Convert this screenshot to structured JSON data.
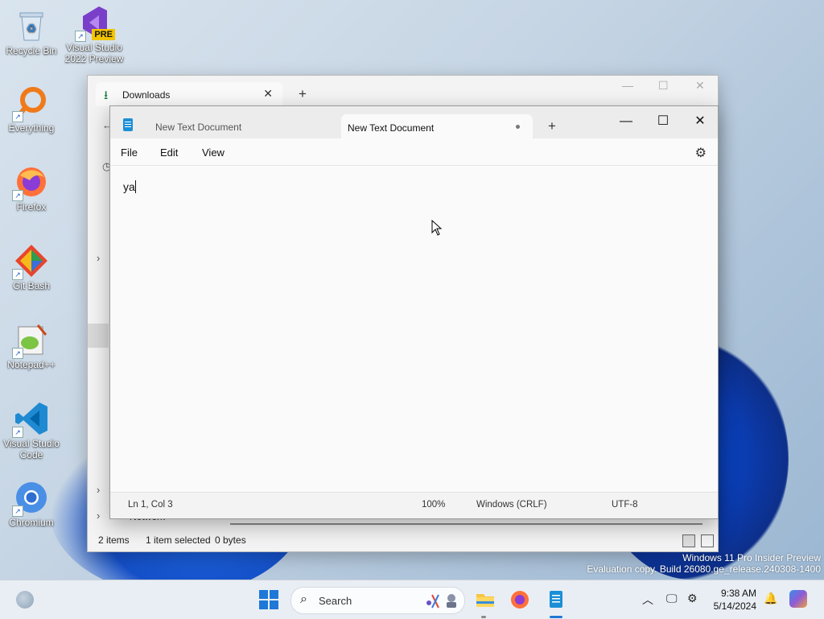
{
  "desktop": {
    "icons": [
      {
        "label": "Recycle Bin"
      },
      {
        "label": "Visual Studio 2022 Preview",
        "badge": "PRE"
      },
      {
        "label": "Everything"
      },
      {
        "label": "Firefox"
      },
      {
        "label": "Git Bash"
      },
      {
        "label": "Notepad++"
      },
      {
        "label": "Visual Studio Code"
      },
      {
        "label": "Chromium"
      }
    ]
  },
  "explorer": {
    "tab_title": "Downloads",
    "status": {
      "items": "2 items",
      "selected": "1 item selected",
      "size": "0 bytes"
    },
    "nav_label": "Network"
  },
  "notepad": {
    "tabs": [
      {
        "label": "New Text Document"
      },
      {
        "label": "New Text Document",
        "modified": true
      }
    ],
    "menu": [
      "File",
      "Edit",
      "View"
    ],
    "content": "ya",
    "status": {
      "position": "Ln 1, Col 3",
      "zoom": "100%",
      "line_ending": "Windows (CRLF)",
      "encoding": "UTF-8"
    }
  },
  "taskbar": {
    "search_placeholder": "Search",
    "time": "9:38 AM",
    "date": "5/14/2024"
  },
  "watermark": {
    "line1": "Windows 11 Pro Insider Preview",
    "line2": "Evaluation copy. Build 26080.ge_release.240308-1400"
  },
  "colors": {
    "accent": "#1e78d7",
    "wallpaper_bloom": "#0b3cb0"
  }
}
